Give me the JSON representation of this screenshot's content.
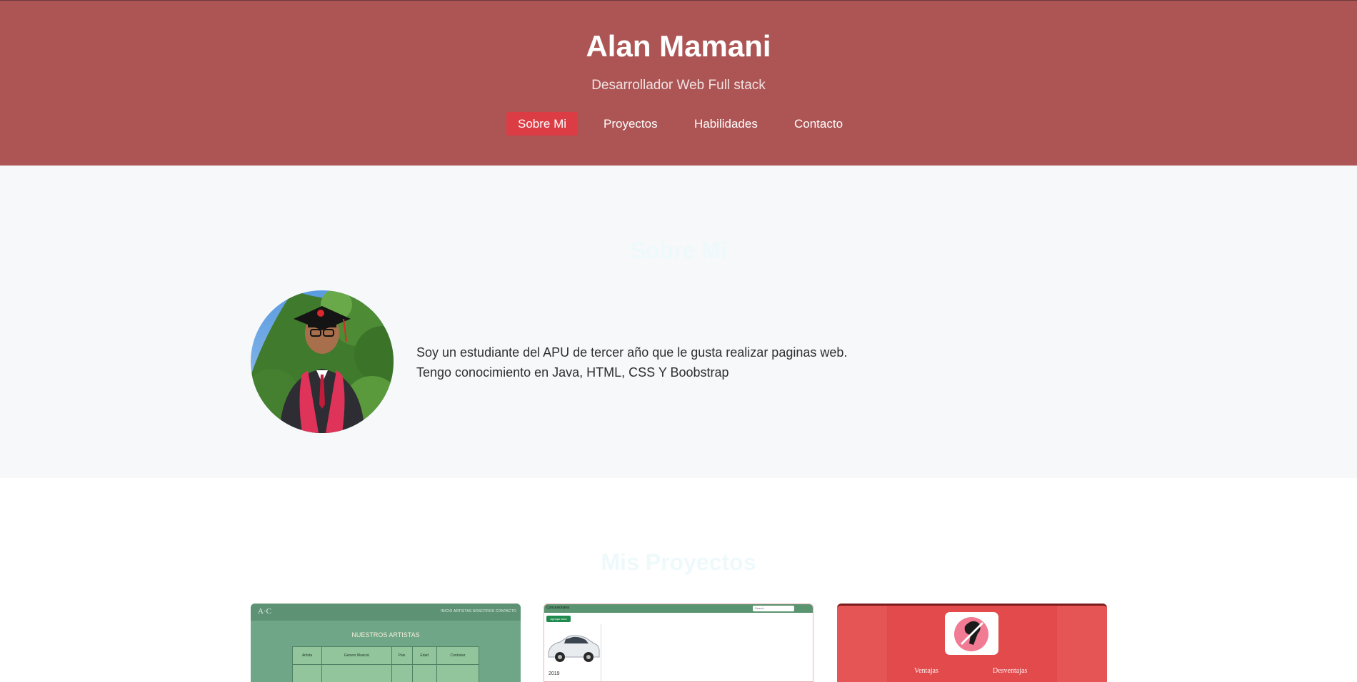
{
  "header": {
    "title": "Alan Mamani",
    "subtitle": "Desarrollador Web Full stack",
    "nav": [
      {
        "label": "Sobre Mi"
      },
      {
        "label": "Proyectos"
      },
      {
        "label": "Habilidades"
      },
      {
        "label": "Contacto"
      }
    ],
    "background_color": "#ad5555",
    "active_nav_color": "#dc3d45"
  },
  "about": {
    "heading": "Sobre Mi",
    "text_line_1": "Soy un estudiante del APU de tercer año que le gusta realizar paginas web.",
    "text_line_2": "Tengo conocimiento en Java, HTML, CSS Y Boobstrap",
    "avatar_icon": "profile-photo"
  },
  "projects": {
    "heading": "Mis Proyectos",
    "cards": [
      {
        "logo": "A·C",
        "nav_links": "INICIO   ARTISTAS   NOSOTROS   CONTACTO",
        "title": "NUESTROS ARTISTAS",
        "table_headers": [
          "Artista",
          "Genero Musical",
          "Pais",
          "Edad",
          "Contratar"
        ]
      },
      {
        "brand": "Concesionaria",
        "search_placeholder": "Search",
        "button": "Agregar Auto",
        "year": "2019"
      },
      {
        "left_label": "Ventajas",
        "right_label": "Desventajas"
      }
    ]
  }
}
